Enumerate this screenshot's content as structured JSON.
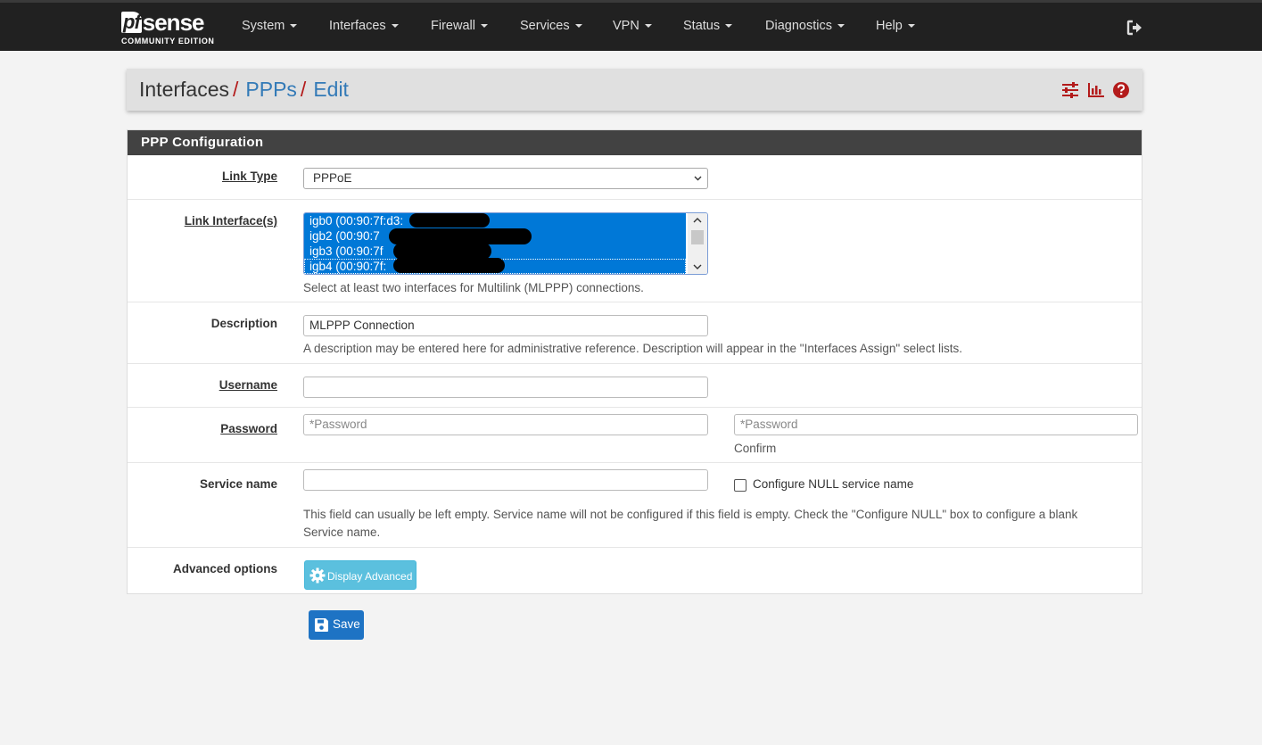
{
  "brand": {
    "pf": "pf",
    "sense": "sense",
    "edition": "COMMUNITY EDITION"
  },
  "nav": [
    {
      "label": "System"
    },
    {
      "label": "Interfaces"
    },
    {
      "label": "Firewall"
    },
    {
      "label": "Services"
    },
    {
      "label": "VPN"
    },
    {
      "label": "Status"
    },
    {
      "label": "Diagnostics"
    },
    {
      "label": "Help"
    }
  ],
  "breadcrumb": {
    "root": "Interfaces",
    "section": "PPPs",
    "page": "Edit",
    "separator": "/"
  },
  "header_icons": [
    "sliders-icon",
    "bar-chart-icon",
    "help-circle-icon"
  ],
  "panel": {
    "title": "PPP Configuration",
    "link_type": {
      "label": "Link Type",
      "value": "PPPoE"
    },
    "link_interfaces": {
      "label": "Link Interface(s)",
      "options": [
        "igb0 (00:90:7f:d3:",
        "igb2 (00:90:7",
        "igb3 (00:90:7f",
        "igb4 (00:90:7f:"
      ],
      "help": "Select at least two interfaces for Multilink (MLPPP) connections."
    },
    "description": {
      "label": "Description",
      "value": "MLPPP Connection",
      "help": "A description may be entered here for administrative reference. Description will appear in the \"Interfaces Assign\" select lists."
    },
    "username": {
      "label": "Username",
      "value": ""
    },
    "password": {
      "label": "Password",
      "placeholder": "*Password",
      "confirm_placeholder": "*Password",
      "confirm_label": "Confirm"
    },
    "service_name": {
      "label": "Service name",
      "value": "",
      "null_checkbox_label": "Configure NULL service name",
      "null_checked": false,
      "help_line1": "This field can usually be left empty. Service name will not be configured if this field is empty. Check the \"Configure NULL\" box to configure a blank",
      "help_line2": "Service name."
    },
    "advanced": {
      "label": "Advanced options",
      "button": "Display Advanced"
    }
  },
  "save_button": "Save",
  "colors": {
    "navbar": "#212121",
    "accent_red": "#b31b1b",
    "link_blue": "#337ab7",
    "selection": "#0078d7",
    "info_button": "#5bc0de",
    "primary_button": "#1e73c4"
  }
}
